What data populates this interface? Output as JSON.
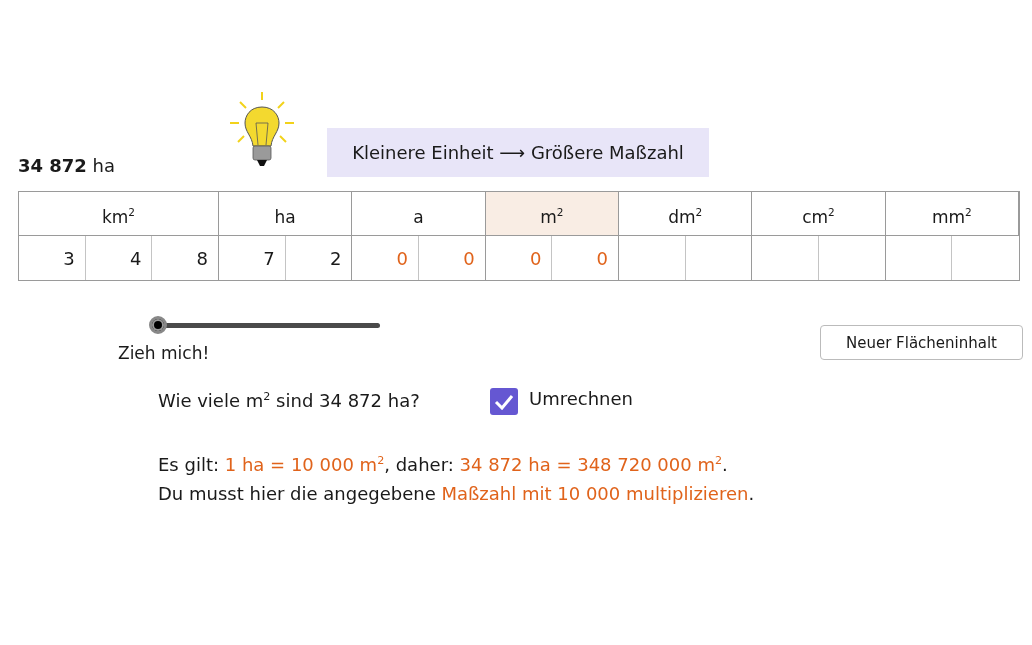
{
  "amount": "**34 872** ha",
  "banner": "Kleinere Einheit ⟶ Größere Maßzahl",
  "table": {
    "columns": [
      {
        "label": "km$^{2}$",
        "selected": false,
        "cells": [
          {
            "kind": "given",
            "value": "3"
          },
          {
            "kind": "given",
            "value": "4"
          },
          {
            "kind": "given",
            "value": "8"
          }
        ]
      },
      {
        "label": "ha",
        "selected": false,
        "cells": [
          {
            "kind": "given",
            "value": "7"
          },
          {
            "kind": "given",
            "value": "2"
          }
        ]
      },
      {
        "label": "a",
        "selected": false,
        "cells": [
          {
            "kind": "added",
            "value": "0"
          },
          {
            "kind": "added",
            "value": "0"
          }
        ]
      },
      {
        "label": "m$^{2}$",
        "selected": true,
        "cells": [
          {
            "kind": "added",
            "value": "0"
          },
          {
            "kind": "added",
            "value": "0"
          }
        ]
      },
      {
        "label": "dm$^{2}$",
        "selected": false,
        "cells": [
          {
            "kind": "empty"
          },
          {
            "kind": "empty"
          }
        ]
      },
      {
        "label": "cm$^{2}$",
        "selected": false,
        "cells": [
          {
            "kind": "empty"
          },
          {
            "kind": "empty"
          }
        ]
      },
      {
        "label": "mm$^{2}$",
        "selected": false,
        "cells": [
          {
            "kind": "empty"
          },
          {
            "kind": "empty"
          }
        ]
      }
    ]
  },
  "slider": {
    "label": "Zieh mich!",
    "level": 0
  },
  "new_button": "Neuer Flächeninhalt",
  "question": "Wie viele m$^{2}$ sind 34 872 ha?",
  "convert": {
    "label": "Umrechnen",
    "checked": true
  },
  "explanation": [
    [
      {
        "text": "Es gilt: ",
        "highlight": false
      },
      {
        "text": "1 ha = 10 000 m$^{2}$",
        "highlight": true
      },
      {
        "text": ", daher: ",
        "highlight": false
      },
      {
        "text": "34 872 ha = 348 720 000 m$^{2}$",
        "highlight": true
      },
      {
        "text": ".",
        "highlight": false
      }
    ],
    [
      {
        "text": "Du musst hier die angegebene ",
        "highlight": false
      },
      {
        "text": "Maßzahl mit 10 000 multiplizieren",
        "highlight": true
      },
      {
        "text": ".",
        "highlight": false
      }
    ]
  ]
}
